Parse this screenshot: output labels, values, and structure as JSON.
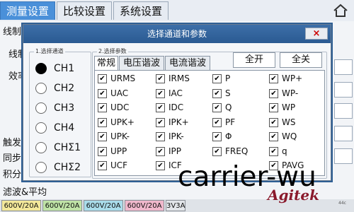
{
  "tabs": [
    {
      "label": "测量设置",
      "active": true
    },
    {
      "label": "比较设置",
      "active": false
    },
    {
      "label": "系统设置",
      "active": false
    }
  ],
  "background": {
    "labels": [
      "线制",
      "线制",
      "效率",
      "触发",
      "同步",
      "积分",
      "滤波&平均"
    ]
  },
  "dialog": {
    "title": "选择通道和参数",
    "close_symbol": "×",
    "channel_group": {
      "legend": "1.选择通道",
      "channels": [
        {
          "label": "CH1",
          "selected": true
        },
        {
          "label": "CH2",
          "selected": false
        },
        {
          "label": "CH3",
          "selected": false
        },
        {
          "label": "CH4",
          "selected": false
        },
        {
          "label": "CHΣ1",
          "selected": false
        },
        {
          "label": "CHΣ2",
          "selected": false
        }
      ]
    },
    "param_group": {
      "legend": "2.选择参数",
      "tabs": [
        {
          "label": "常规",
          "active": true
        },
        {
          "label": "电压谐波",
          "active": false
        },
        {
          "label": "电流谐波",
          "active": false
        }
      ],
      "select_all_label": "全开",
      "clear_all_label": "全关",
      "params": [
        [
          "URMS",
          "IRMS",
          "P",
          "WP+"
        ],
        [
          "UAC",
          "IAC",
          "S",
          "WP-"
        ],
        [
          "UDC",
          "IDC",
          "Q",
          "WP"
        ],
        [
          "UPK+",
          "IPK+",
          "PF",
          "WS"
        ],
        [
          "UPK-",
          "IPK-",
          "Φ",
          "WQ"
        ],
        [
          "UPP",
          "IPP",
          "FREQ",
          "q"
        ],
        [
          "UCF",
          "ICF",
          "",
          "PAVG"
        ]
      ],
      "checkmark": "✔"
    }
  },
  "statusbar": {
    "cells": [
      {
        "label": "600V/20A",
        "color": "#f3e89a"
      },
      {
        "label": "600V/20A",
        "color": "#bfe3a6"
      },
      {
        "label": "600V/20A",
        "color": "#a9dcea"
      },
      {
        "label": "600V/20A",
        "color": "#f0b8cc"
      },
      {
        "label": "3V3A",
        "color": "#e2e5e9"
      }
    ],
    "tiny_text": "44c"
  },
  "watermark_text": "carrier-wu",
  "logo_text": "Agitek",
  "accent_color": "#4a90d9"
}
